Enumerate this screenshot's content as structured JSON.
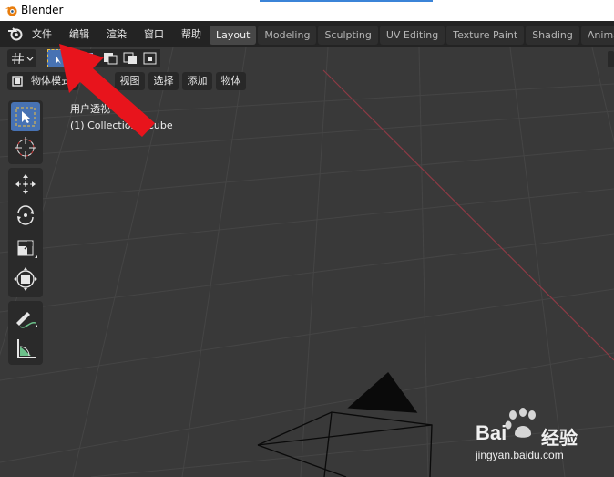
{
  "window": {
    "title": "Blender"
  },
  "menu": {
    "items": [
      "文件",
      "编辑",
      "渲染",
      "窗口",
      "帮助"
    ]
  },
  "workspaces": {
    "tabs": [
      "Layout",
      "Modeling",
      "Sculpting",
      "UV Editing",
      "Texture Paint",
      "Shading",
      "Animat"
    ],
    "active": "Layout"
  },
  "header": {
    "mode": "物体模式",
    "menu": [
      "视图",
      "选择",
      "添加",
      "物体"
    ]
  },
  "viewport": {
    "view_name": "用户透视",
    "collection": "(1) Collection | Cube"
  },
  "watermark": {
    "brand": "Bai",
    "brand2": "经验",
    "url": "jingyan.baidu.com"
  },
  "colors": {
    "accent": "#4772b3",
    "arrow": "#e8141c",
    "x_axis": "#8c3a45"
  },
  "icons": [
    "blender-logo-icon",
    "select-box-icon",
    "cursor-icon",
    "move-icon",
    "rotate-icon",
    "scale-icon",
    "transform-icon",
    "annotate-icon",
    "measure-icon"
  ]
}
